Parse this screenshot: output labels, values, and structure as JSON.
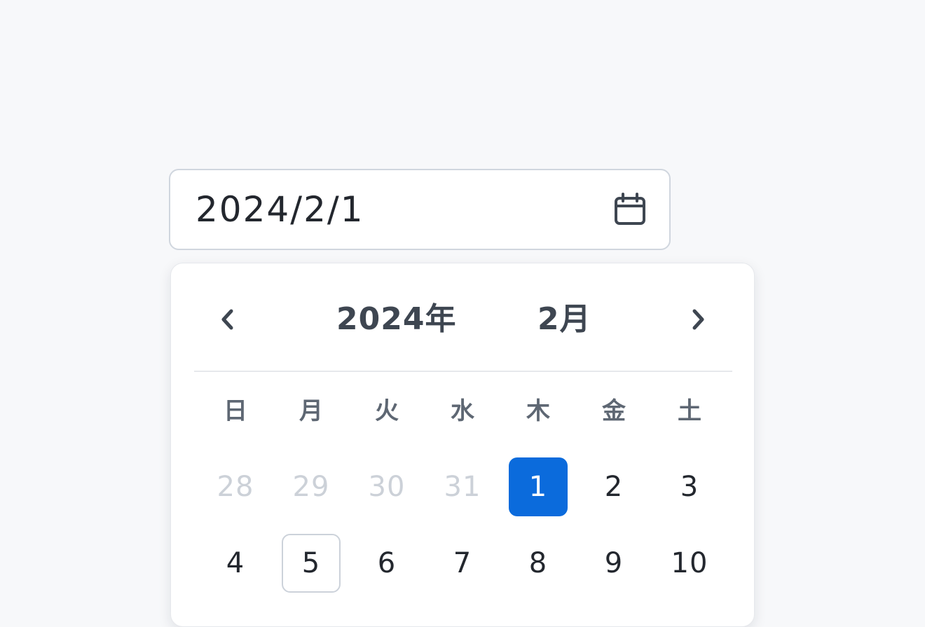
{
  "input": {
    "value": "2024/2/1",
    "icon": "calendar-icon"
  },
  "calendar": {
    "header": {
      "year_label": "2024年",
      "month_label": "2月",
      "prev_icon": "chevron-left-icon",
      "next_icon": "chevron-right-icon"
    },
    "weekdays": [
      "日",
      "月",
      "火",
      "水",
      "木",
      "金",
      "土"
    ],
    "days": [
      {
        "label": "28",
        "state": "outside"
      },
      {
        "label": "29",
        "state": "outside"
      },
      {
        "label": "30",
        "state": "outside"
      },
      {
        "label": "31",
        "state": "outside"
      },
      {
        "label": "1",
        "state": "selected"
      },
      {
        "label": "2",
        "state": "normal"
      },
      {
        "label": "3",
        "state": "normal"
      },
      {
        "label": "4",
        "state": "normal"
      },
      {
        "label": "5",
        "state": "today"
      },
      {
        "label": "6",
        "state": "normal"
      },
      {
        "label": "7",
        "state": "normal"
      },
      {
        "label": "8",
        "state": "normal"
      },
      {
        "label": "9",
        "state": "normal"
      },
      {
        "label": "10",
        "state": "normal"
      }
    ]
  },
  "colors": {
    "accent": "#0b6bdc",
    "text": "#23272e",
    "muted": "#ccd1d8"
  }
}
